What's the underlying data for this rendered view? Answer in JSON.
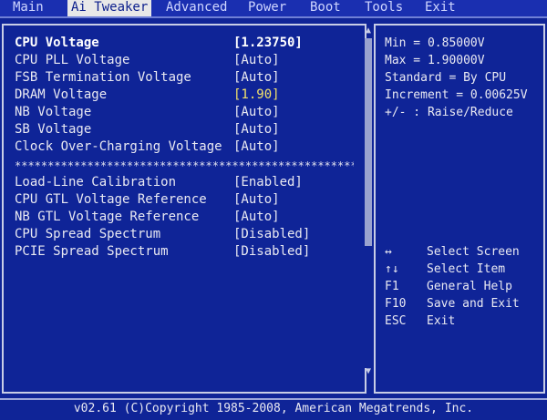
{
  "menu": {
    "items": [
      "Main",
      "Ai Tweaker",
      "Advanced",
      "Power",
      "Boot",
      "Tools",
      "Exit"
    ],
    "active": "Ai Tweaker"
  },
  "settings": [
    {
      "label": "CPU Voltage",
      "value": "[1.23750]",
      "selected": true
    },
    {
      "label": "CPU PLL Voltage",
      "value": "[Auto]"
    },
    {
      "label": "FSB Termination Voltage",
      "value": "[Auto]"
    },
    {
      "label": "DRAM Voltage",
      "value": "[1.90]",
      "highlight": true
    },
    {
      "label": "NB Voltage",
      "value": "[Auto]"
    },
    {
      "label": "SB Voltage",
      "value": "[Auto]"
    },
    {
      "label": "Clock Over-Charging Voltage",
      "value": "[Auto]"
    }
  ],
  "separator": "******************************************************",
  "settings2": [
    {
      "label": "Load-Line Calibration",
      "value": "[Enabled]"
    },
    {
      "label": "CPU GTL Voltage Reference",
      "value": "[Auto]"
    },
    {
      "label": "NB GTL Voltage Reference",
      "value": "[Auto]"
    },
    {
      "label": "CPU Spread Spectrum",
      "value": "[Disabled]"
    },
    {
      "label": "PCIE Spread Spectrum",
      "value": "[Disabled]"
    }
  ],
  "help": {
    "lines": [
      "Min = 0.85000V",
      "Max = 1.90000V",
      "Standard = By CPU",
      "Increment = 0.00625V",
      "+/- : Raise/Reduce"
    ]
  },
  "keys": [
    {
      "key": "↔",
      "desc": "Select Screen"
    },
    {
      "key": "↑↓",
      "desc": "Select Item"
    },
    {
      "key": "F1",
      "desc": "General Help"
    },
    {
      "key": "F10",
      "desc": "Save and Exit"
    },
    {
      "key": "ESC",
      "desc": "Exit"
    }
  ],
  "footer": "v02.61 (C)Copyright 1985-2008, American Megatrends, Inc.",
  "scroll_position": 0.0
}
